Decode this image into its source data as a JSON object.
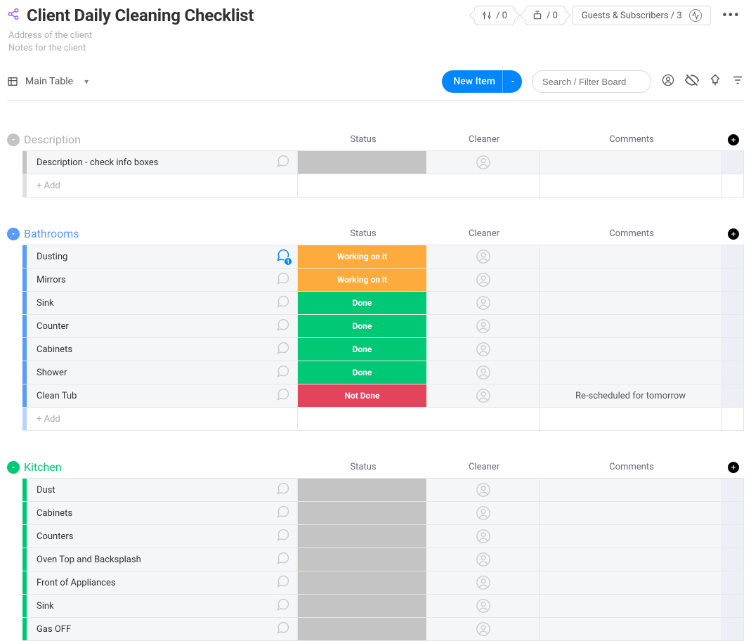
{
  "header": {
    "title": "Client Daily Cleaning Checklist",
    "subtitle_line1": "Address of the client",
    "subtitle_line2": "Notes for the client",
    "integrations_count": "/ 0",
    "automations_count": "/ 0",
    "guests_label": "Guests & Subscribers / 3"
  },
  "toolbar": {
    "view_label": "Main Table",
    "new_item_label": "New Item",
    "search_placeholder": "Search / Filter Board"
  },
  "columns": {
    "status": "Status",
    "cleaner": "Cleaner",
    "comments": "Comments"
  },
  "add_row_label": "+ Add",
  "status_labels": {
    "workingonit": "Working on it",
    "done": "Done",
    "notdone": "Not Done"
  },
  "groups": [
    {
      "name": "Description",
      "color": "grey",
      "rows": [
        {
          "name": "Description - check info boxes",
          "status": "empty",
          "has_notif": false,
          "comment": ""
        }
      ],
      "has_add": true
    },
    {
      "name": "Bathrooms",
      "color": "blue",
      "rows": [
        {
          "name": "Dusting",
          "status": "workingonit",
          "has_notif": true,
          "notif_count": "1",
          "comment": ""
        },
        {
          "name": "Mirrors",
          "status": "workingonit",
          "has_notif": false,
          "comment": ""
        },
        {
          "name": "Sink",
          "status": "done",
          "has_notif": false,
          "comment": ""
        },
        {
          "name": "Counter",
          "status": "done",
          "has_notif": false,
          "comment": ""
        },
        {
          "name": "Cabinets",
          "status": "done",
          "has_notif": false,
          "comment": ""
        },
        {
          "name": "Shower",
          "status": "done",
          "has_notif": false,
          "comment": ""
        },
        {
          "name": "Clean Tub",
          "status": "notdone",
          "has_notif": false,
          "comment": "Re-scheduled for tomorrow"
        }
      ],
      "has_add": true
    },
    {
      "name": "Kitchen",
      "color": "green",
      "rows": [
        {
          "name": "Dust",
          "status": "empty",
          "has_notif": false,
          "comment": ""
        },
        {
          "name": "Cabinets",
          "status": "empty",
          "has_notif": false,
          "comment": ""
        },
        {
          "name": "Counters",
          "status": "empty",
          "has_notif": false,
          "comment": ""
        },
        {
          "name": "Oven Top and Backsplash",
          "status": "empty",
          "has_notif": false,
          "comment": ""
        },
        {
          "name": "Front of Appliances",
          "status": "empty",
          "has_notif": false,
          "comment": ""
        },
        {
          "name": "Sink",
          "status": "empty",
          "has_notif": false,
          "comment": ""
        },
        {
          "name": "Gas OFF",
          "status": "empty",
          "has_notif": false,
          "comment": ""
        }
      ],
      "has_add": false
    }
  ]
}
